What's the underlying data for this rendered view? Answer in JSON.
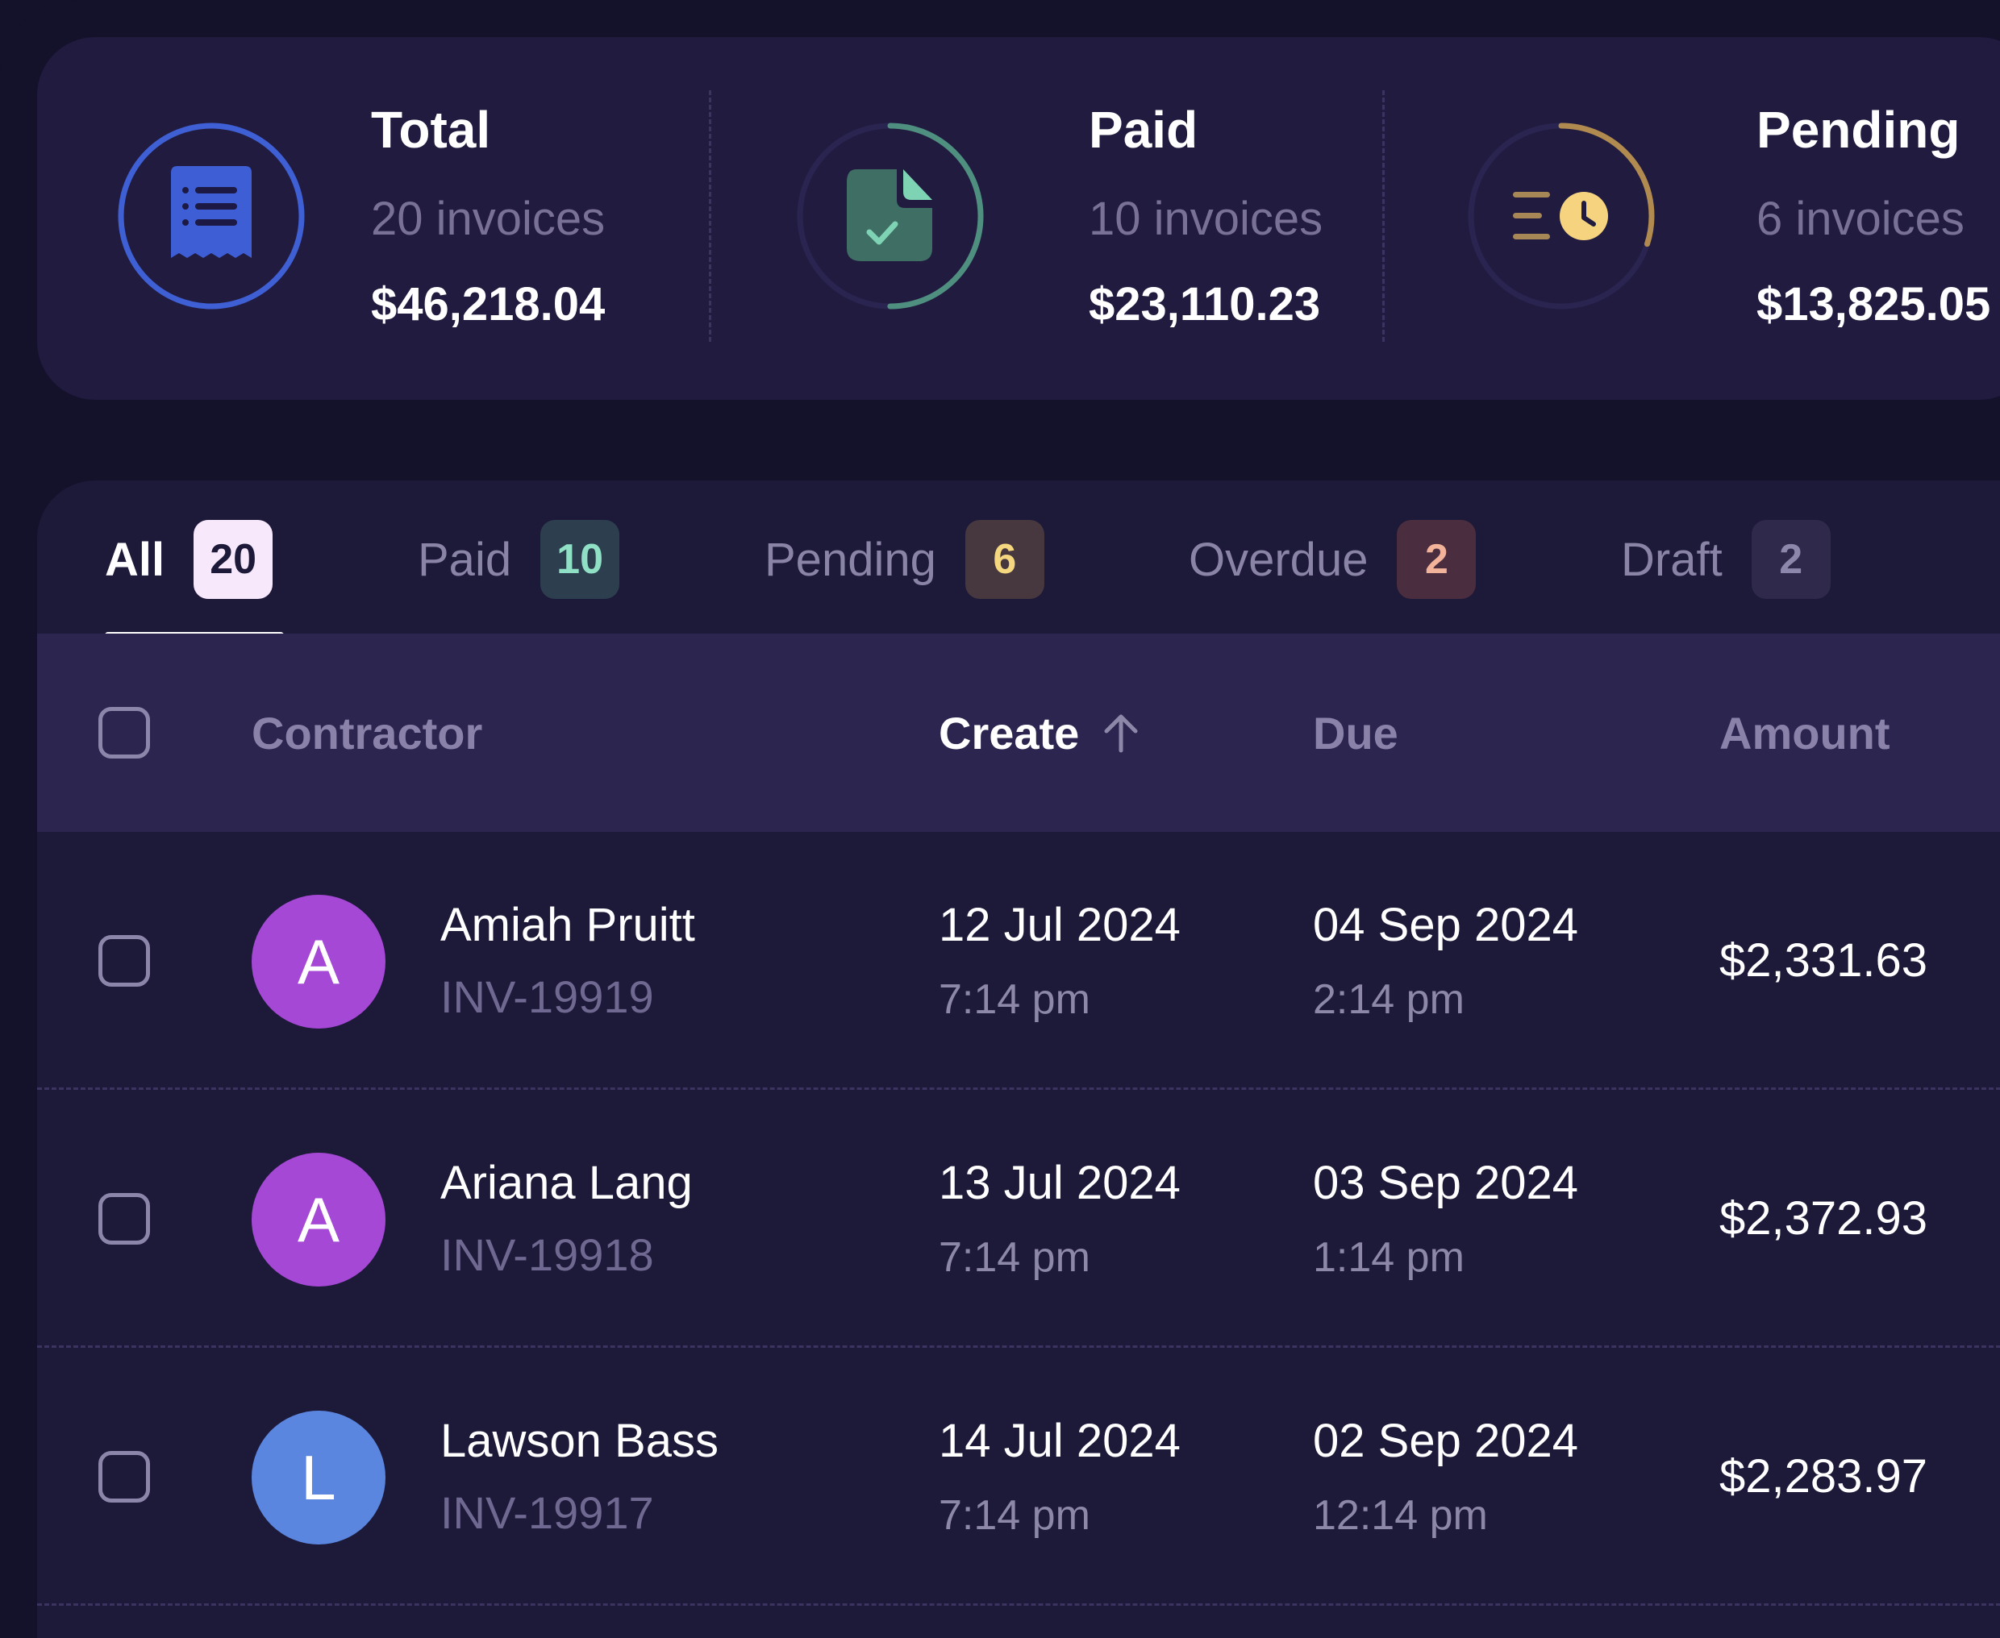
{
  "summary": [
    {
      "title": "Total",
      "count": "20 invoices",
      "amount": "$46,218.04",
      "icon": "receipt-icon",
      "color": "#3f5fd4",
      "progress": 1.0
    },
    {
      "title": "Paid",
      "count": "10 invoices",
      "amount": "$23,110.23",
      "icon": "document-check-icon",
      "color": "#4f8f7f",
      "progress": 0.5
    },
    {
      "title": "Pending",
      "count": "6 invoices",
      "amount": "$13,825.05",
      "icon": "clock-list-icon",
      "color": "#b08a4f",
      "progress": 0.3
    }
  ],
  "tabs": [
    {
      "label": "All",
      "count": "20",
      "active": true,
      "badge_bg": "#f8e8fb",
      "badge_fg": "#1d1939"
    },
    {
      "label": "Paid",
      "count": "10",
      "active": false,
      "badge_bg": "#2d3f4f",
      "badge_fg": "#8fe0c5"
    },
    {
      "label": "Pending",
      "count": "6",
      "active": false,
      "badge_bg": "#46383e",
      "badge_fg": "#f5d77f"
    },
    {
      "label": "Overdue",
      "count": "2",
      "active": false,
      "badge_bg": "#4a2d3e",
      "badge_fg": "#f3b39a"
    },
    {
      "label": "Draft",
      "count": "2",
      "active": false,
      "badge_bg": "#2f2a4c",
      "badge_fg": "#8d87ab"
    }
  ],
  "table": {
    "columns": {
      "contractor": "Contractor",
      "create": "Create",
      "due": "Due",
      "amount": "Amount"
    },
    "rows": [
      {
        "initial": "A",
        "avatar_color": "#a548d6",
        "name": "Amiah Pruitt",
        "invoice": "INV-19919",
        "create_date": "12 Jul 2024",
        "create_time": "7:14 pm",
        "due_date": "04 Sep 2024",
        "due_time": "2:14 pm",
        "amount": "$2,331.63"
      },
      {
        "initial": "A",
        "avatar_color": "#a548d6",
        "name": "Ariana Lang",
        "invoice": "INV-19918",
        "create_date": "13 Jul 2024",
        "create_time": "7:14 pm",
        "due_date": "03 Sep 2024",
        "due_time": "1:14 pm",
        "amount": "$2,372.93"
      },
      {
        "initial": "L",
        "avatar_color": "#5a86e0",
        "name": "Lawson Bass",
        "invoice": "INV-19917",
        "create_date": "14 Jul 2024",
        "create_time": "7:14 pm",
        "due_date": "02 Sep 2024",
        "due_time": "12:14 pm",
        "amount": "$2,283.97"
      }
    ]
  }
}
